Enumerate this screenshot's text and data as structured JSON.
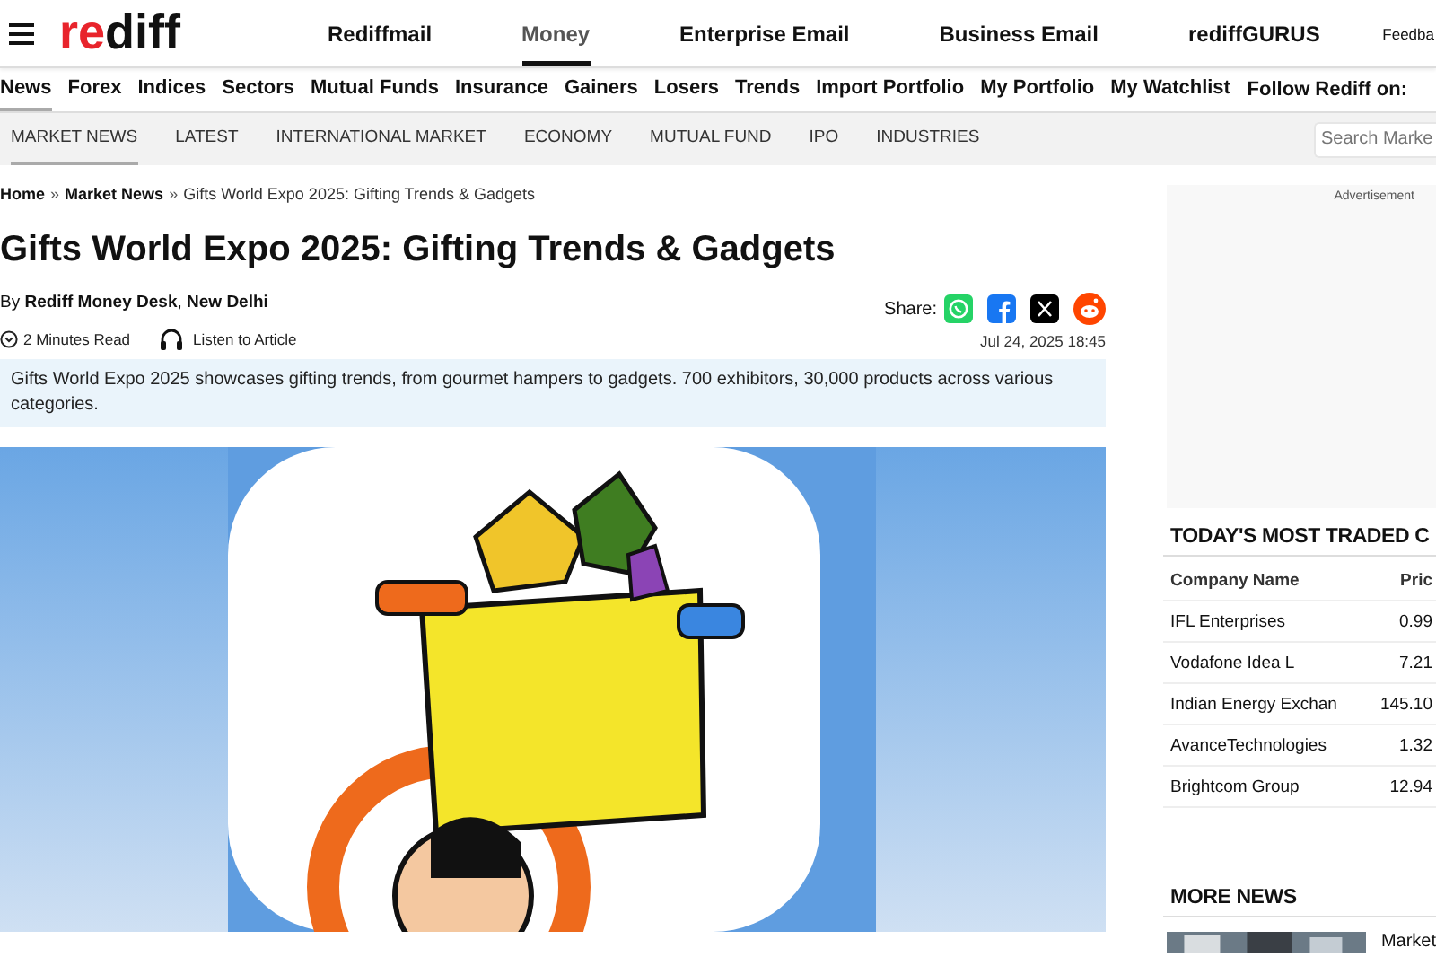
{
  "header": {
    "logo": [
      "re",
      "diff"
    ],
    "nav": [
      {
        "label": "Rediffmail",
        "selected": false
      },
      {
        "label": "Money",
        "selected": true
      },
      {
        "label": "Enterprise Email",
        "selected": false
      },
      {
        "label": "Business Email",
        "selected": false
      },
      {
        "label": "rediffGURUS",
        "selected": false
      }
    ],
    "feedback": "Feedba"
  },
  "section_nav": {
    "items": [
      {
        "label": "News",
        "selected": true
      },
      {
        "label": "Forex",
        "selected": false
      },
      {
        "label": "Indices",
        "selected": false
      },
      {
        "label": "Sectors",
        "selected": false
      },
      {
        "label": "Mutual Funds",
        "selected": false
      },
      {
        "label": "Insurance",
        "selected": false
      },
      {
        "label": "Gainers",
        "selected": false
      },
      {
        "label": "Losers",
        "selected": false
      },
      {
        "label": "Trends",
        "selected": false
      },
      {
        "label": "Import Portfolio",
        "selected": false
      },
      {
        "label": "My Portfolio",
        "selected": false
      },
      {
        "label": "My Watchlist",
        "selected": false
      }
    ],
    "follow": "Follow Rediff on:"
  },
  "sub_nav": {
    "items": [
      {
        "label": "MARKET NEWS",
        "selected": true
      },
      {
        "label": "LATEST",
        "selected": false
      },
      {
        "label": "INTERNATIONAL MARKET",
        "selected": false
      },
      {
        "label": "ECONOMY",
        "selected": false
      },
      {
        "label": "MUTUAL FUND",
        "selected": false
      },
      {
        "label": "IPO",
        "selected": false
      },
      {
        "label": "INDUSTRIES",
        "selected": false
      }
    ],
    "search": {
      "placeholder": "Search Marke"
    }
  },
  "article": {
    "breadcrumb_separator": "»",
    "breadcrumb": [
      "Home",
      "Market News",
      "Gifts World Expo 2025: Gifting Trends & Gadgets"
    ],
    "title": "Gifts World Expo 2025: Gifting Trends & Gadgets",
    "byline": "By **Rediff Money Desk**, **New Delhi**",
    "share_label": "Share:",
    "share": [
      {
        "kind": "whatsapp"
      },
      {
        "kind": "facebook"
      },
      {
        "kind": "x"
      },
      {
        "kind": "reddit"
      }
    ],
    "read_time": "2 Minutes Read",
    "listen": "Listen to Article",
    "date": "Jul 24, 2025 18:45",
    "summary": "Gifts World Expo 2025 showcases gifting trends, from gourmet hampers to gadgets. 700 exhibitors, 30,000 products across various categories.",
    "image": {
      "kind": "picture"
    }
  },
  "sidebar": {
    "ad_label": "Advertisement",
    "most_traded": {
      "title": "TODAY'S MOST TRADED C",
      "columns": [
        "Company Name",
        "Pric"
      ],
      "rows": [
        {
          "name": "IFL Enterprises",
          "price": "0.99"
        },
        {
          "name": "Vodafone Idea L",
          "price": "7.21"
        },
        {
          "name": "Indian Energy Exchan",
          "price": "145.10"
        },
        {
          "name": "AvanceTechnologies",
          "price": "1.32"
        },
        {
          "name": "Brightcom Group",
          "price": "12.94"
        }
      ]
    },
    "more_news": {
      "title": "MORE NEWS",
      "items": [
        {
          "title": "Market",
          "image": {
            "kind": "picture"
          }
        }
      ]
    }
  }
}
